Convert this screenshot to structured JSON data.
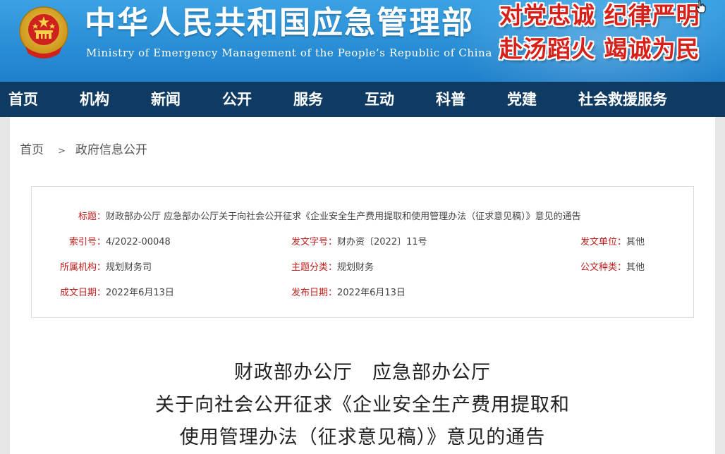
{
  "header": {
    "title": "中华人民共和国应急管理部",
    "subtitle": "Ministry of Emergency Management of the People’s Republic of China",
    "slogan_line1": "对党忠诚 纪律严明",
    "slogan_line2": "赴汤蹈火 竭诚为民",
    "colors": {
      "header_blue": "#2a8fd6",
      "slogan_red": "#d8201a",
      "nav_navy": "#0f3a61"
    },
    "emblem_icon": "national-emblem-icon",
    "cursor_icon": "hand-pointer-icon"
  },
  "nav": {
    "items": [
      "首页",
      "机构",
      "新闻",
      "公开",
      "服务",
      "互动",
      "科普",
      "党建",
      "社会救援服务"
    ]
  },
  "breadcrumb": {
    "home": "首页",
    "separator": ">",
    "current": "政府信息公开"
  },
  "meta": {
    "title_label": "标题：",
    "title_value": "财政部办公厅 应急部办公厅关于向社会公开征求《企业安全生产费用提取和使用管理办法（征求意见稿）》意见的通告",
    "index_label": "索引号：",
    "index_value": "4/2022-00048",
    "doc_no_label": "发文字号：",
    "doc_no_value": "财办资〔2022〕11号",
    "issuer_label": "发文单位：",
    "issuer_value": "其他",
    "org_label": "所属机构：",
    "org_value": "规划财务司",
    "topic_label": "主题分类：",
    "topic_value": "规划财务",
    "type_label": "公文种类：",
    "type_value": "其他",
    "created_label": "成文日期：",
    "created_value": "2022年6月13日",
    "published_label": "发布日期：",
    "published_value": "2022年6月13日"
  },
  "document": {
    "title_line1": "财政部办公厅　应急部办公厅",
    "title_line2": "关于向社会公开征求《企业安全生产费用提取和",
    "title_line3": "使用管理办法（征求意见稿）》意见的通告"
  }
}
